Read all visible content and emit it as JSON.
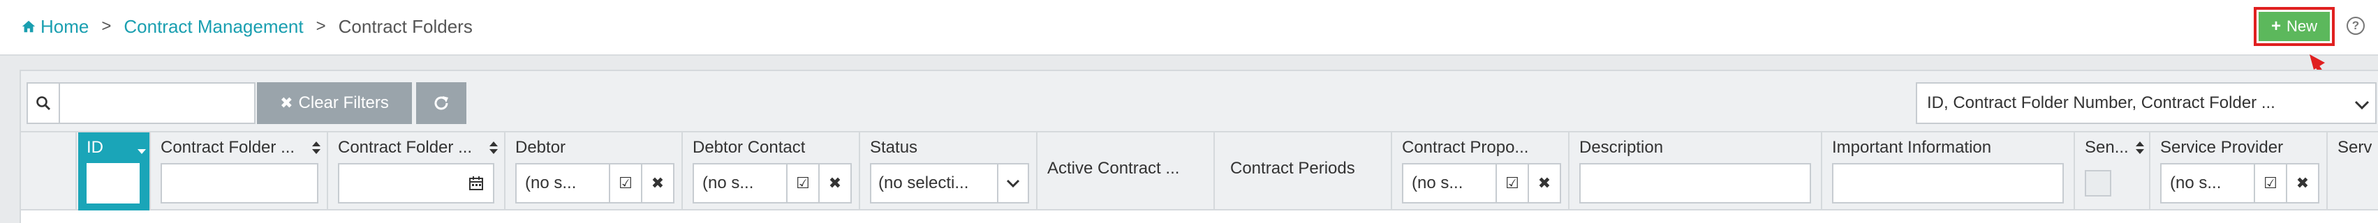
{
  "breadcrumb": {
    "home": "Home",
    "separator": ">",
    "section": "Contract Management",
    "current": "Contract Folders"
  },
  "header": {
    "new_label": "New",
    "help_label": "?"
  },
  "toolbar": {
    "search_value": "",
    "clear_filters_label": "Clear Filters",
    "columns_select_value": "ID, Contract Folder Number, Contract Folder ..."
  },
  "columns": [
    {
      "label": "ID",
      "filter": "none"
    },
    {
      "label": "Contract Folder ...",
      "filter": "text"
    },
    {
      "label": "Contract Folder ...",
      "filter": "date"
    },
    {
      "label": "Debtor",
      "filter": "picker",
      "value": "(no s..."
    },
    {
      "label": "Debtor Contact",
      "filter": "picker",
      "value": "(no s..."
    },
    {
      "label": "Status",
      "filter": "select",
      "value": "(no selecti..."
    },
    {
      "label": "Active Contract ...",
      "filter": "none"
    },
    {
      "label": "Contract Periods",
      "filter": "none"
    },
    {
      "label": "Contract Propo...",
      "filter": "picker",
      "value": "(no s..."
    },
    {
      "label": "Description",
      "filter": "text"
    },
    {
      "label": "Important Information",
      "filter": "text"
    },
    {
      "label": "Sen...",
      "filter": "checkbox"
    },
    {
      "label": "Service Provider",
      "filter": "picker",
      "value": "(no s..."
    },
    {
      "label": "Serv",
      "filter": "none"
    }
  ],
  "colors": {
    "accent": "#1aa5b8",
    "new_button": "#5cb85c",
    "highlight": "#e02020",
    "toolbar_button": "#9aa4ab"
  }
}
